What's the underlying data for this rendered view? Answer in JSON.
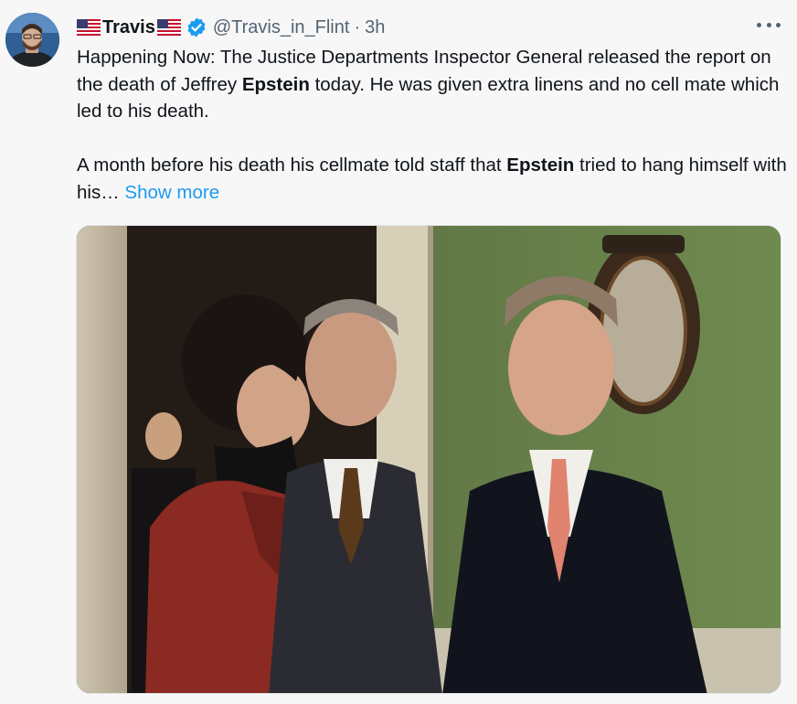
{
  "author": {
    "display_name": "Travis",
    "handle": "@Travis_in_Flint",
    "separator": "·",
    "timestamp": "3h",
    "verified": true,
    "flag_icon": "us-flag-icon"
  },
  "tweet": {
    "line1_pre": "Happening Now:  The Justice Departments Inspector General released the report on the death of Jeffrey ",
    "line1_bold": "Epstein",
    "line1_post": " today.  He was given extra linens and no cell mate which led to his death.",
    "line2_pre": "A month before his death his cellmate told staff that ",
    "line2_bold": "Epstein",
    "line2_post": " tried to hang himself with his…",
    "show_more": "Show more"
  },
  "colors": {
    "link": "#1d9bf0",
    "verified_badge": "#1d9bf0",
    "secondary_text": "#536471"
  }
}
